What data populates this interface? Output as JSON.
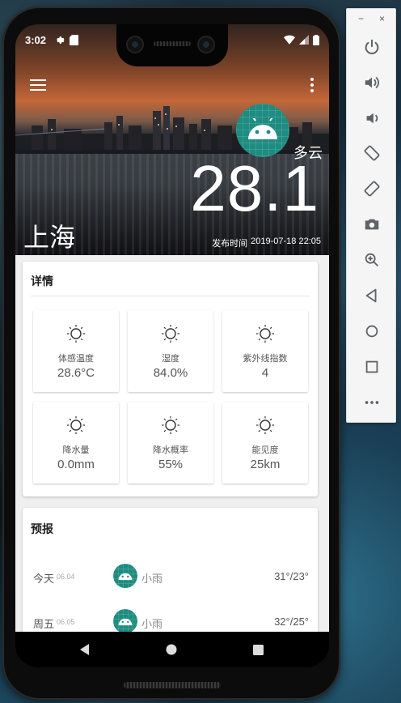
{
  "status_bar": {
    "time": "3:02"
  },
  "hero": {
    "condition": "多云",
    "temperature": "28.1",
    "city": "上海",
    "publish_label": "发布时间",
    "publish_time": "2019-07-18 22:05"
  },
  "details": {
    "title": "详情",
    "tiles": [
      {
        "label": "体感温度",
        "value": "28.6°C"
      },
      {
        "label": "湿度",
        "value": "84.0%"
      },
      {
        "label": "紫外线指数",
        "value": "4"
      },
      {
        "label": "降水量",
        "value": "0.0mm"
      },
      {
        "label": "降水概率",
        "value": "55%"
      },
      {
        "label": "能见度",
        "value": "25km"
      }
    ]
  },
  "forecast": {
    "title": "预报",
    "rows": [
      {
        "day": "今天",
        "date": "06.04",
        "condition": "小雨",
        "temp": "31°/23°"
      },
      {
        "day": "周五",
        "date": "06.05",
        "condition": "小雨",
        "temp": "32°/25°"
      }
    ]
  },
  "emulator": {
    "minimize": "−",
    "close": "×",
    "buttons": [
      "power-icon",
      "volume-up-icon",
      "volume-down-icon",
      "rotate-left-icon",
      "rotate-right-icon",
      "camera-icon",
      "zoom-icon",
      "back-icon",
      "home-icon",
      "overview-icon",
      "more-icon"
    ]
  },
  "colors": {
    "accent_teal": "#1e8c80",
    "background": "#f0f0f0"
  }
}
